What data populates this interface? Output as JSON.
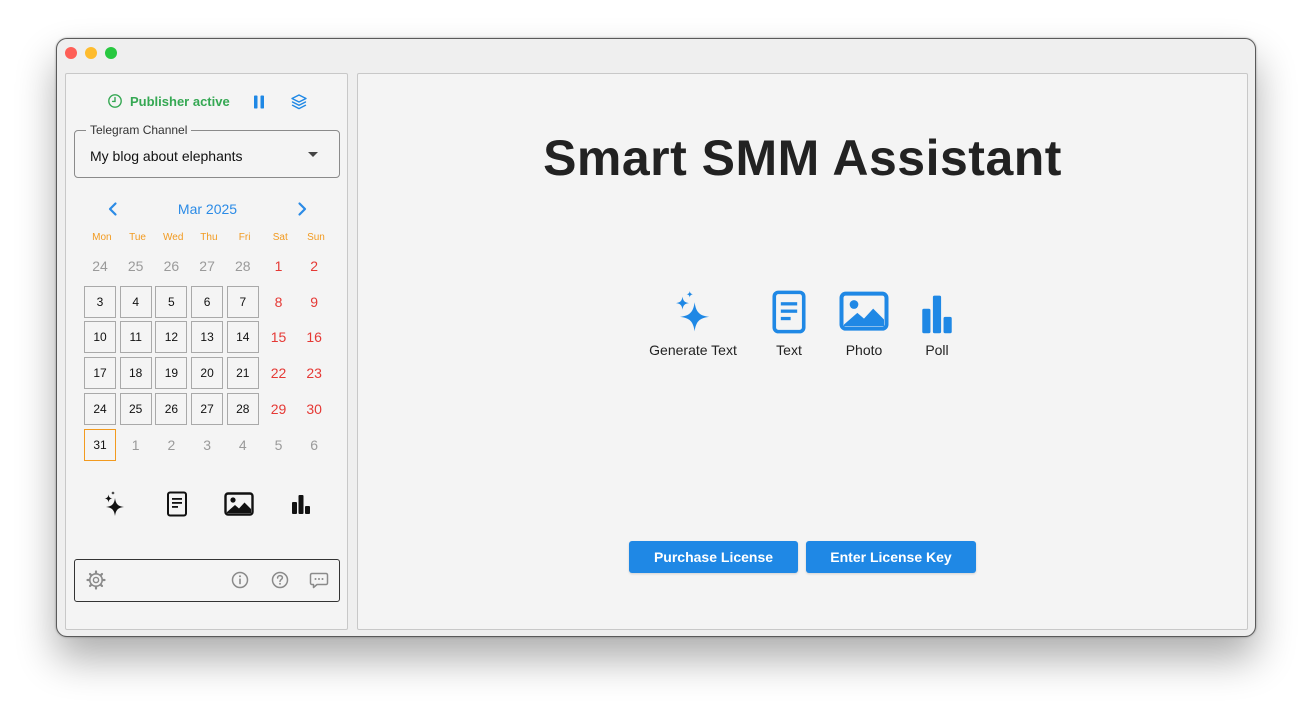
{
  "status": {
    "text": "Publisher active",
    "color": "#35a853",
    "icons": [
      "clock-icon",
      "pause-icon",
      "layers-icon"
    ]
  },
  "channel": {
    "legend": "Telegram Channel",
    "value": "My blog about elephants"
  },
  "calendar": {
    "month_label": "Mar 2025",
    "weekdays": [
      "Mon",
      "Tue",
      "Wed",
      "Thu",
      "Fri",
      "Sat",
      "Sun"
    ],
    "days": [
      {
        "label": "24",
        "kind": "other"
      },
      {
        "label": "25",
        "kind": "other"
      },
      {
        "label": "26",
        "kind": "other"
      },
      {
        "label": "27",
        "kind": "other"
      },
      {
        "label": "28",
        "kind": "other"
      },
      {
        "label": "1",
        "kind": "weekend"
      },
      {
        "label": "2",
        "kind": "weekend"
      },
      {
        "label": "3",
        "kind": "cur"
      },
      {
        "label": "4",
        "kind": "cur"
      },
      {
        "label": "5",
        "kind": "cur"
      },
      {
        "label": "6",
        "kind": "cur"
      },
      {
        "label": "7",
        "kind": "cur"
      },
      {
        "label": "8",
        "kind": "weekend"
      },
      {
        "label": "9",
        "kind": "weekend"
      },
      {
        "label": "10",
        "kind": "cur"
      },
      {
        "label": "11",
        "kind": "cur"
      },
      {
        "label": "12",
        "kind": "cur"
      },
      {
        "label": "13",
        "kind": "cur"
      },
      {
        "label": "14",
        "kind": "cur"
      },
      {
        "label": "15",
        "kind": "weekend"
      },
      {
        "label": "16",
        "kind": "weekend"
      },
      {
        "label": "17",
        "kind": "cur"
      },
      {
        "label": "18",
        "kind": "cur"
      },
      {
        "label": "19",
        "kind": "cur"
      },
      {
        "label": "20",
        "kind": "cur"
      },
      {
        "label": "21",
        "kind": "cur"
      },
      {
        "label": "22",
        "kind": "weekend"
      },
      {
        "label": "23",
        "kind": "weekend"
      },
      {
        "label": "24",
        "kind": "cur"
      },
      {
        "label": "25",
        "kind": "cur"
      },
      {
        "label": "26",
        "kind": "cur"
      },
      {
        "label": "27",
        "kind": "cur"
      },
      {
        "label": "28",
        "kind": "cur"
      },
      {
        "label": "29",
        "kind": "weekend"
      },
      {
        "label": "30",
        "kind": "weekend"
      },
      {
        "label": "31",
        "kind": "today"
      },
      {
        "label": "1",
        "kind": "other"
      },
      {
        "label": "2",
        "kind": "other"
      },
      {
        "label": "3",
        "kind": "other"
      },
      {
        "label": "4",
        "kind": "other"
      },
      {
        "label": "5",
        "kind": "other"
      },
      {
        "label": "6",
        "kind": "other"
      }
    ],
    "colors": {
      "accent": "#2b8be6",
      "weekday": "#f29a1f",
      "weekend": "#e53935",
      "today": "#f29a1f"
    }
  },
  "sidebar_quick_icons": [
    "sparkles-icon",
    "document-icon",
    "image-icon",
    "poll-icon"
  ],
  "footer_icons": [
    "settings-icon",
    "info-icon",
    "help-icon",
    "feedback-icon"
  ],
  "main": {
    "title": "Smart SMM Assistant",
    "post_types": [
      {
        "label": "Generate Text",
        "icon": "sparkles-icon"
      },
      {
        "label": "Text",
        "icon": "document-icon"
      },
      {
        "label": "Photo",
        "icon": "image-icon"
      },
      {
        "label": "Poll",
        "icon": "poll-icon"
      }
    ],
    "buttons": {
      "purchase": "Purchase License",
      "enter_key": "Enter License Key"
    },
    "accent": "#1f88e5"
  }
}
